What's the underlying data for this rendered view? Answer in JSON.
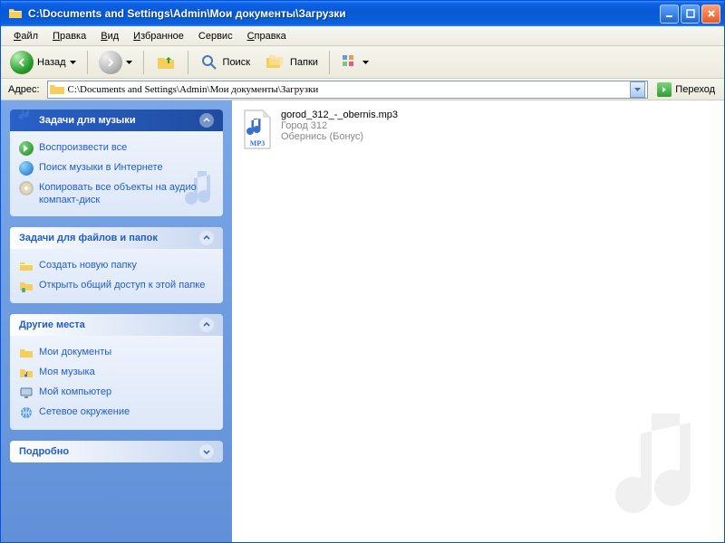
{
  "window": {
    "title": "C:\\Documents and Settings\\Admin\\Мои документы\\Загрузки"
  },
  "menubar": [
    {
      "ul": "Ф",
      "rest": "айл"
    },
    {
      "ul": "П",
      "rest": "равка"
    },
    {
      "ul": "В",
      "rest": "ид"
    },
    {
      "ul": "И",
      "rest": "збранное"
    },
    {
      "ul": "",
      "rest": "Сервис"
    },
    {
      "ul": "С",
      "rest": "правка"
    }
  ],
  "toolbar": {
    "back": "Назад",
    "search": "Поиск",
    "folders": "Папки"
  },
  "addressbar": {
    "label": "Адрес:",
    "value": "C:\\Documents and Settings\\Admin\\Мои документы\\Загрузки",
    "go": "Переход"
  },
  "sidebar": {
    "music": {
      "title": "Задачи для музыки",
      "items": [
        "Воспроизвести все",
        "Поиск музыки в Интернете",
        "Копировать все объекты на аудио компакт-диск"
      ]
    },
    "files": {
      "title": "Задачи для файлов и папок",
      "items": [
        "Создать новую папку",
        "Открыть общий доступ к этой папке"
      ]
    },
    "places": {
      "title": "Другие места",
      "items": [
        "Мои документы",
        "Моя музыка",
        "Мой компьютер",
        "Сетевое окружение"
      ]
    },
    "details": {
      "title": "Подробно"
    }
  },
  "files": [
    {
      "name": "gorod_312_-_obernis.mp3",
      "artist": "Город 312",
      "title": "Обернись (Бонус)"
    }
  ]
}
